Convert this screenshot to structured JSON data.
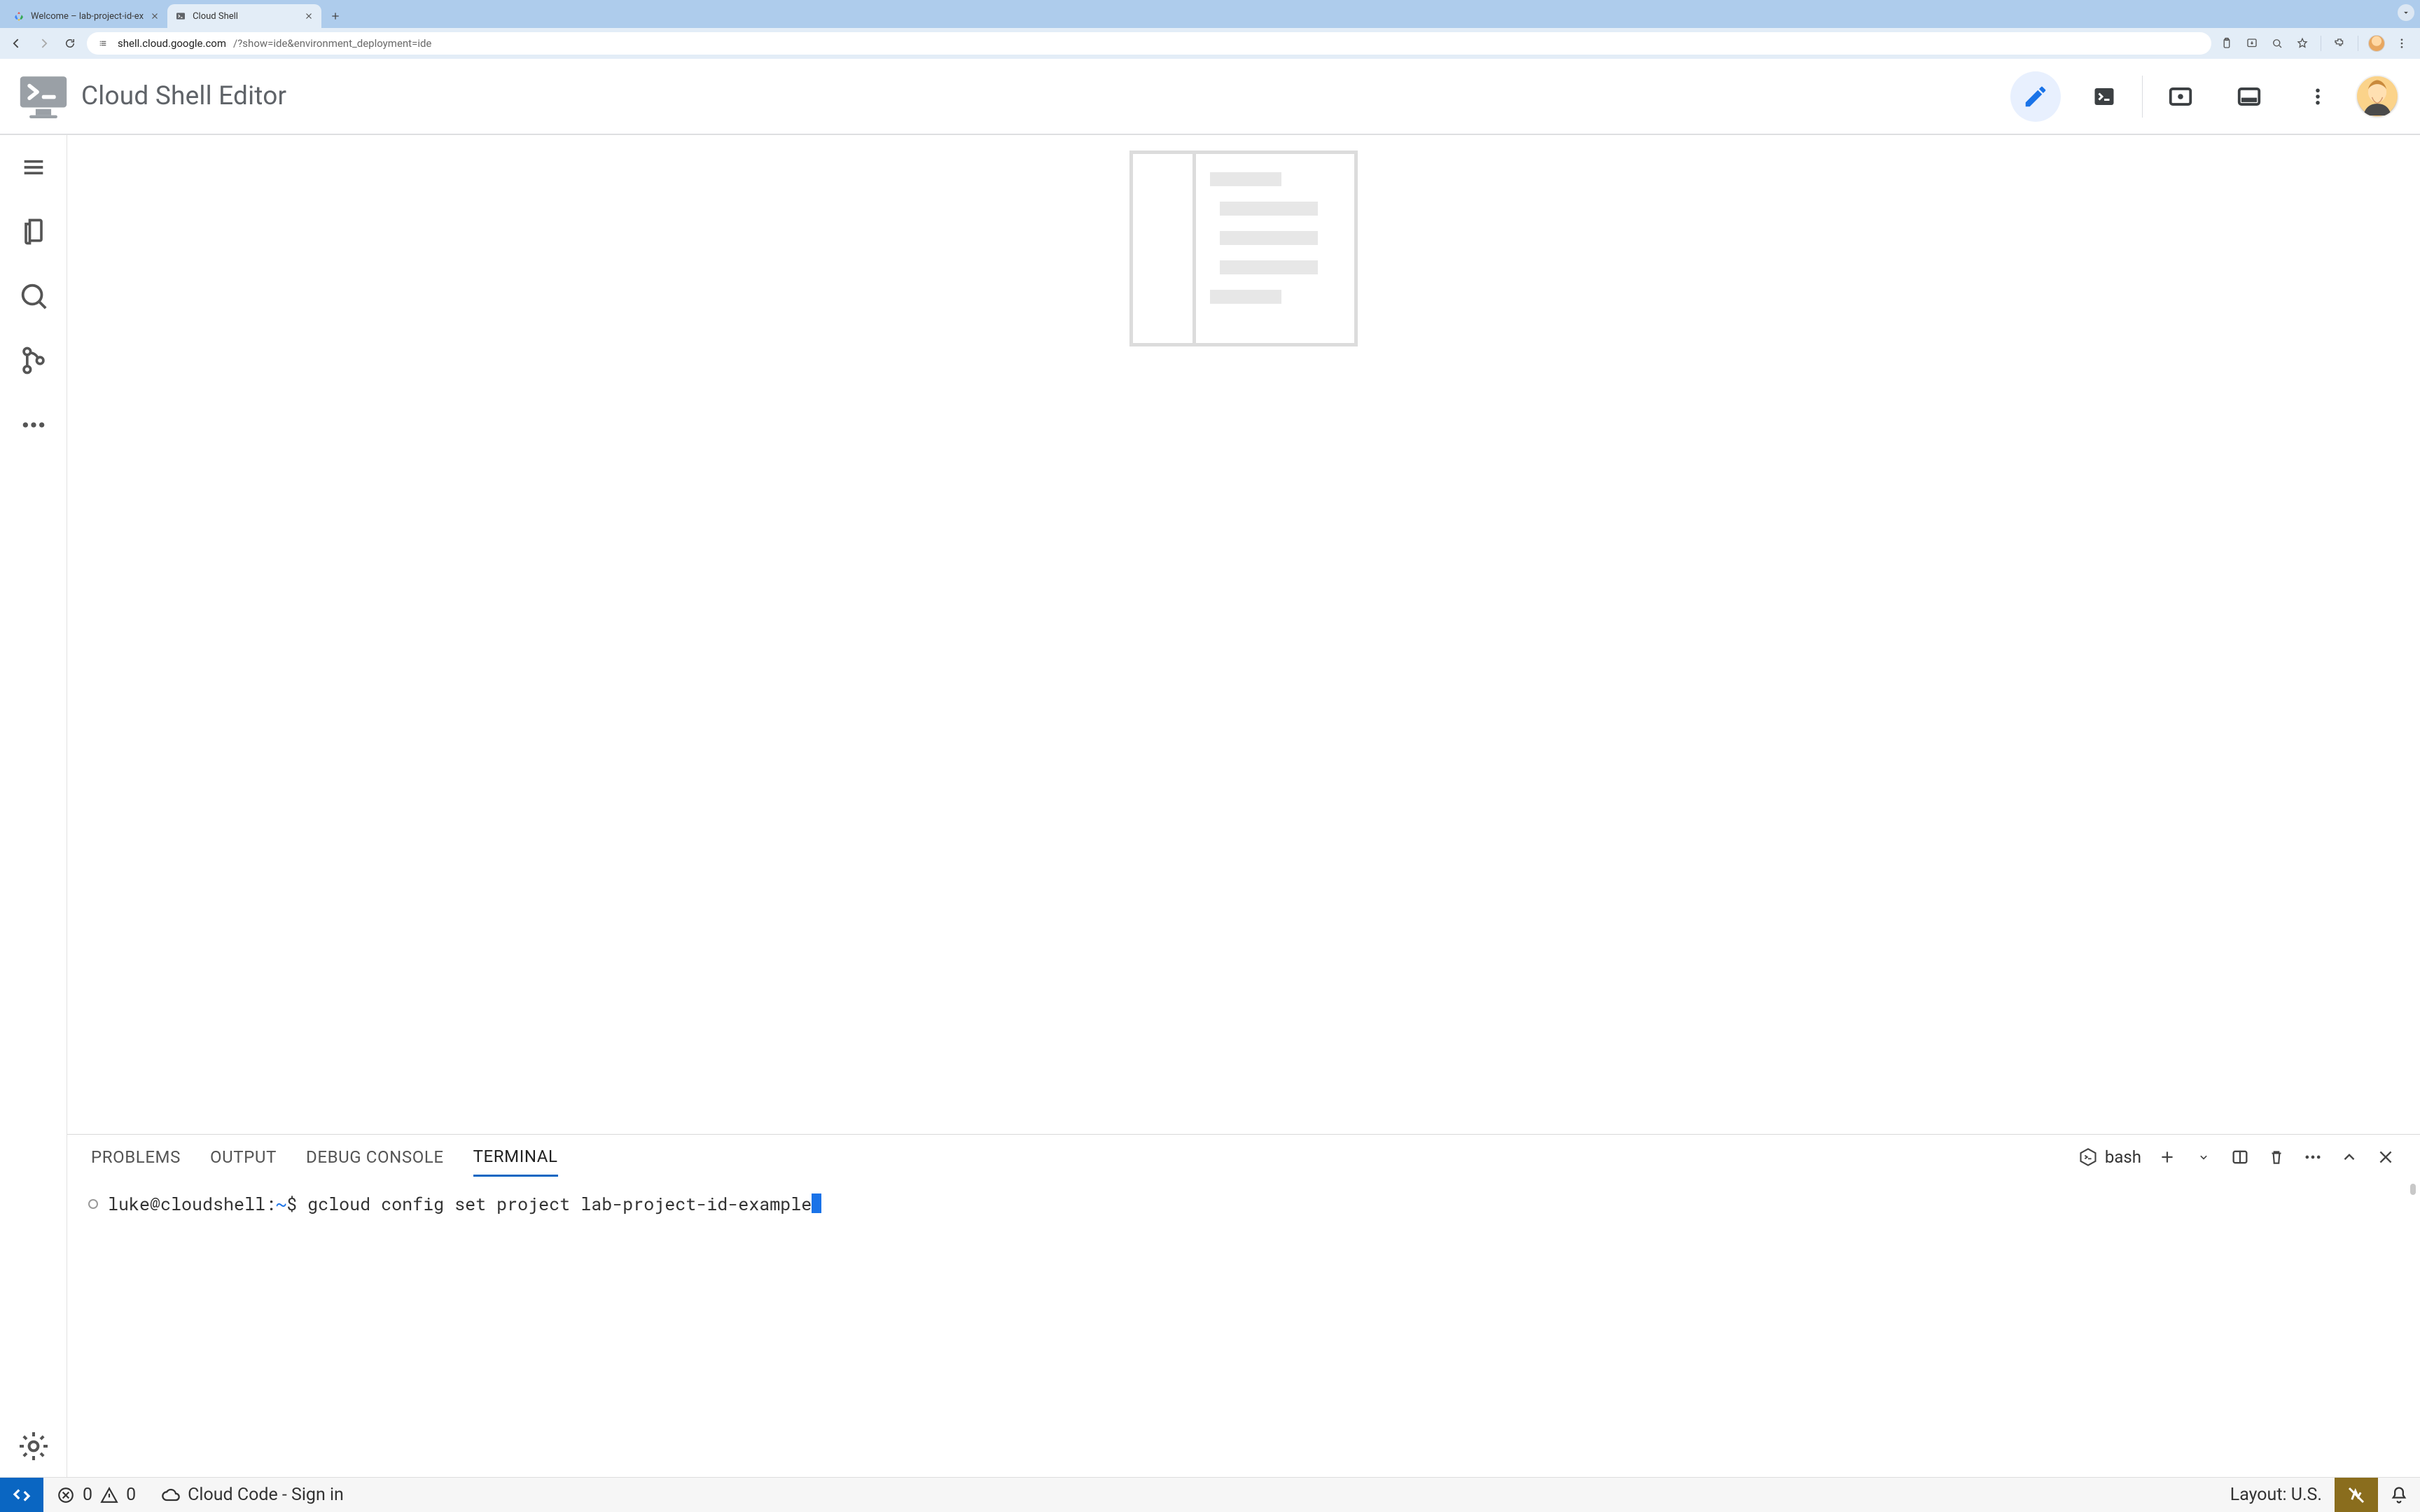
{
  "browser": {
    "tabs": [
      {
        "title": "Welcome – lab-project-id-ex",
        "active": false
      },
      {
        "title": "Cloud Shell",
        "active": true
      }
    ],
    "url_host": "shell.cloud.google.com",
    "url_path": "/?show=ide&environment_deployment=ide"
  },
  "cse": {
    "title": "Cloud Shell Editor"
  },
  "panel": {
    "tabs": {
      "problems": "PROBLEMS",
      "output": "OUTPUT",
      "debug": "DEBUG CONSOLE",
      "terminal": "TERMINAL"
    },
    "shell_name": "bash"
  },
  "terminal": {
    "user": "luke",
    "host": "cloudshell",
    "cwd_symbol": "~",
    "prompt_tail": "$",
    "command": "gcloud config set project lab-project-id-example"
  },
  "status_bar": {
    "errors": "0",
    "warnings": "0",
    "cloud_code": "Cloud Code - Sign in",
    "layout": "Layout: U.S."
  }
}
